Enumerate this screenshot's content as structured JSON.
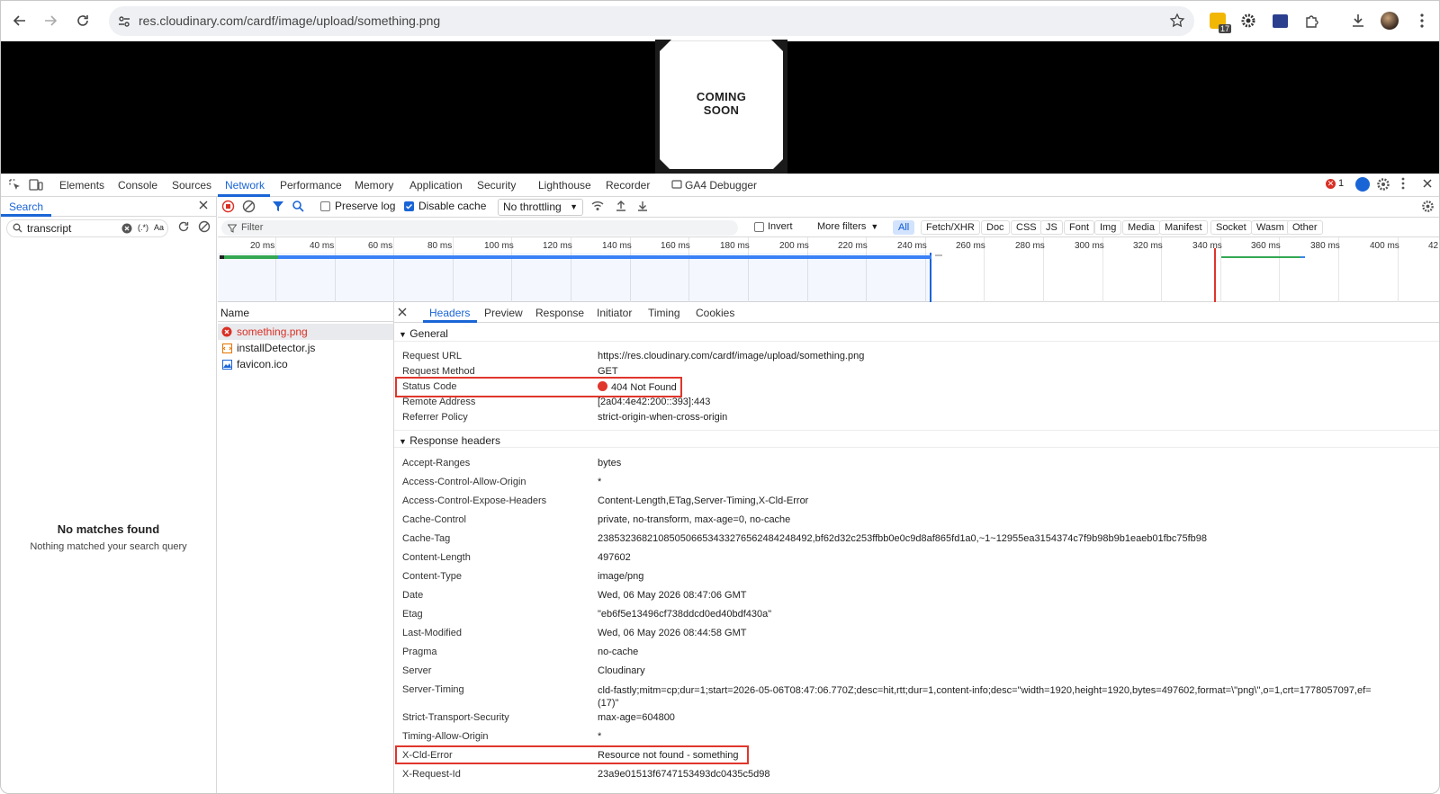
{
  "address_bar": {
    "url": "res.cloudinary.com/cardf/image/upload/something.png"
  },
  "extensions": {
    "badge": "17"
  },
  "page": {
    "sign_line1": "COMING",
    "sign_line2": "SOON"
  },
  "devtools": {
    "tabs": [
      "Elements",
      "Console",
      "Sources",
      "Network",
      "Performance",
      "Memory",
      "Application",
      "Security",
      "Lighthouse",
      "Recorder",
      "GA4 Debugger"
    ],
    "active_tab": "Network",
    "error_count": "1"
  },
  "search": {
    "tab_label": "Search",
    "query": "transcript",
    "regex_label": "(.*)",
    "case_label": "Aa",
    "no_matches_title": "No matches found",
    "no_matches_sub": "Nothing matched your search query"
  },
  "network_toolbar": {
    "preserve_log": "Preserve log",
    "preserve_checked": false,
    "disable_cache": "Disable cache",
    "disable_checked": true,
    "throttling": "No throttling"
  },
  "filter_bar": {
    "placeholder": "Filter",
    "invert": "Invert",
    "more_filters": "More filters",
    "types": [
      "All",
      "Fetch/XHR",
      "Doc",
      "CSS",
      "JS",
      "Font",
      "Img",
      "Media",
      "Manifest",
      "Socket",
      "Wasm",
      "Other"
    ],
    "selected_type": "All"
  },
  "timeline": {
    "tick_labels": [
      "20 ms",
      "40 ms",
      "60 ms",
      "80 ms",
      "100 ms",
      "120 ms",
      "140 ms",
      "160 ms",
      "180 ms",
      "200 ms",
      "220 ms",
      "240 ms",
      "260 ms",
      "280 ms",
      "300 ms",
      "320 ms",
      "340 ms",
      "360 ms",
      "380 ms",
      "400 ms",
      "42"
    ]
  },
  "requests": {
    "column": "Name",
    "items": [
      {
        "name": "something.png",
        "status": "error"
      },
      {
        "name": "installDetector.js",
        "status": "ok"
      },
      {
        "name": "favicon.ico",
        "status": "ok"
      }
    ]
  },
  "detail_tabs": [
    "Headers",
    "Preview",
    "Response",
    "Initiator",
    "Timing",
    "Cookies"
  ],
  "general": {
    "title": "General",
    "rows": [
      {
        "key": "Request URL",
        "value": "https://res.cloudinary.com/cardf/image/upload/something.png"
      },
      {
        "key": "Request Method",
        "value": "GET"
      },
      {
        "key": "Status Code",
        "value": "404 Not Found"
      },
      {
        "key": "Remote Address",
        "value": "[2a04:4e42:200::393]:443"
      },
      {
        "key": "Referrer Policy",
        "value": "strict-origin-when-cross-origin"
      }
    ]
  },
  "response_headers": {
    "title": "Response headers",
    "rows": [
      {
        "key": "Accept-Ranges",
        "value": "bytes"
      },
      {
        "key": "Access-Control-Allow-Origin",
        "value": "*"
      },
      {
        "key": "Access-Control-Expose-Headers",
        "value": "Content-Length,ETag,Server-Timing,X-Cld-Error"
      },
      {
        "key": "Cache-Control",
        "value": "private, no-transform, max-age=0, no-cache"
      },
      {
        "key": "Cache-Tag",
        "value": "238532368210850506653433276562484248492,bf62d32c253ffbb0e0c9d8af865fd1a0,~1~12955ea3154374c7f9b98b9b1eaeb01fbc75fb98"
      },
      {
        "key": "Content-Length",
        "value": "497602"
      },
      {
        "key": "Content-Type",
        "value": "image/png"
      },
      {
        "key": "Date",
        "value": "Wed, 06 May 2026 08:47:06 GMT"
      },
      {
        "key": "Etag",
        "value": "\"eb6f5e13496cf738ddcd0ed40bdf430a\""
      },
      {
        "key": "Last-Modified",
        "value": "Wed, 06 May 2026 08:44:58 GMT"
      },
      {
        "key": "Pragma",
        "value": "no-cache"
      },
      {
        "key": "Server",
        "value": "Cloudinary"
      },
      {
        "key": "Server-Timing",
        "value": "cld-fastly;mitm=cp;dur=1;start=2026-05-06T08:47:06.770Z;desc=hit,rtt;dur=1,content-info;desc=\"width=1920,height=1920,bytes=497602,format=\\\"png\\\",o=1,crt=1778057097,ef=\n(17)\""
      },
      {
        "key": "Strict-Transport-Security",
        "value": "max-age=604800"
      },
      {
        "key": "Timing-Allow-Origin",
        "value": "*"
      },
      {
        "key": "X-Cld-Error",
        "value": "Resource not found - something"
      },
      {
        "key": "X-Request-Id",
        "value": "23a9e01513f6747153493dc0435c5d98"
      }
    ]
  },
  "colors": {
    "accent": "#1a65d6",
    "error": "#d93025",
    "highlight": "#e0362c"
  }
}
